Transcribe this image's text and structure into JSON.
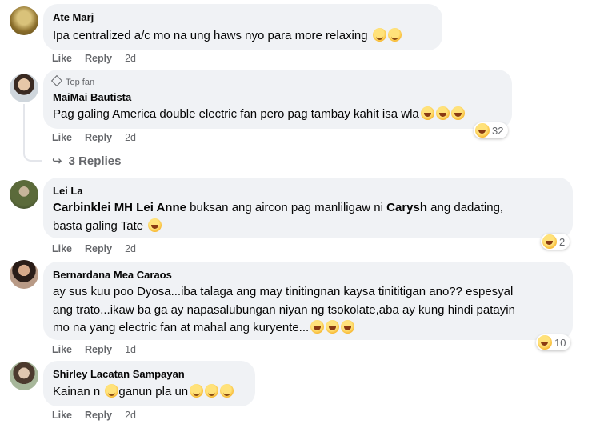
{
  "comments": [
    {
      "name": "Ate Marj",
      "text": "Ipa centralized a/c mo na ung haws nyo para more relaxing",
      "emojis": [
        "smile",
        "smile"
      ],
      "like": "Like",
      "reply": "Reply",
      "time": "2d"
    },
    {
      "badge": "Top fan",
      "name": "MaiMai Bautista",
      "text": "Pag galing America double electric fan pero pag tambay kahit isa wla",
      "emojis": [
        "laugh",
        "laugh",
        "laugh"
      ],
      "like": "Like",
      "reply": "Reply",
      "time": "2d",
      "reactions": {
        "emoji": "laugh",
        "count": "32"
      },
      "replies_label": "3 Replies"
    },
    {
      "name": "Lei La",
      "mention1": "Carbinklei MH Lei Anne",
      "text_mid": " buksan ang aircon pag manliligaw ni ",
      "mention2": "Carysh",
      "text_end": " ang dadating,",
      "line2": "basta galing Tate",
      "emojis": [
        "laugh"
      ],
      "like": "Like",
      "reply": "Reply",
      "time": "2d",
      "reactions": {
        "emoji": "laugh",
        "count": "2"
      }
    },
    {
      "name": "Bernardana Mea Caraos",
      "line1": "ay sus kuu poo Dyosa...iba talaga ang may tinitingnan kaysa tinititigan ano?? espesyal",
      "line2": "ang trato...ikaw ba ga ay napasalubungan niyan ng tsokolate,aba ay kung hindi patayin",
      "line3": "mo na yang electric fan at mahal ang kuryente...",
      "emojis": [
        "laugh",
        "laugh",
        "laugh"
      ],
      "like": "Like",
      "reply": "Reply",
      "time": "1d",
      "reactions": {
        "emoji": "laugh",
        "count": "10"
      }
    },
    {
      "name": "Shirley Lacatan Sampayan",
      "text_a": "Kainan n ",
      "text_b": "ganun pla un",
      "emojis": [
        "smile",
        "smile",
        "smile"
      ],
      "like": "Like",
      "reply": "Reply",
      "time": "2d"
    }
  ]
}
